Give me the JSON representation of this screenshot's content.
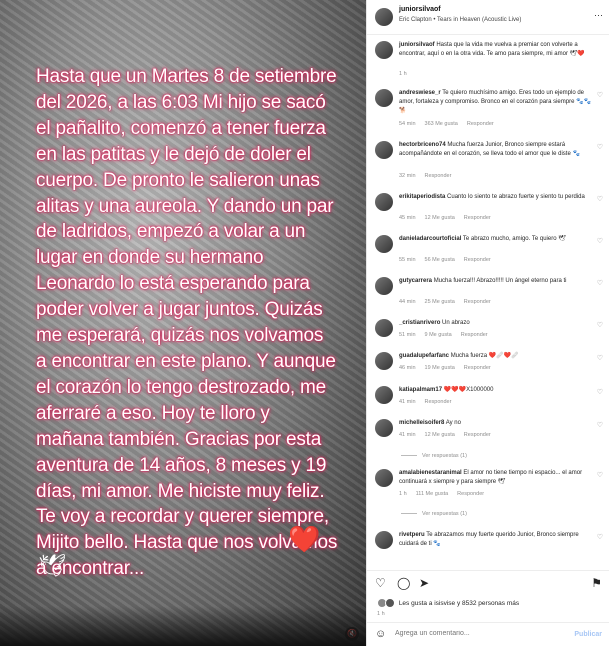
{
  "post": {
    "text": "Hasta que un Martes 8 de setiembre del 2026, a las 6:03 Mi hijo se sacó el pañalito, comenzó a tener fuerza en las patitas y le dejó de doler el cuerpo. De pronto le salieron unas alitas y una aureola. Y dando un par de ladridos, empezó a volar a un lugar en donde su hermano Leonardo lo está esperando para poder volver a jugar juntos. Quizás me esperará, quizás nos volvamos a encontrar en este plano. Y aunque el corazón lo tengo destrozado, me aferraré a eso. Hoy te lloro y mañana también. Gracias por esta aventura de 14 años, 8 meses y 19 días, mi amor. Me hiciste muy feliz. Te voy a recordar y querer siempre, Mijito bello. Hasta que nos volvamos a encontrar...",
    "heart": "❤️",
    "dove": "🕊"
  },
  "header": {
    "username": "juniorsilvaof",
    "song": "Eric Clapton • Tears in Heaven (Acoustic Live)",
    "more": "···"
  },
  "caption": {
    "username": "juniorsilvaof",
    "text": "Hasta que la vida me vuelva a premiar con volverte a encontrar, aquí o en la otra vida. Te amo para siempre, mi amor 🕊❤️",
    "time": "1 h"
  },
  "comments": [
    {
      "user": "andreswiese_r",
      "text": "Te quiero muchísimo amigo. Eres todo un ejemplo de amor, fortaleza y compromiso. Bronco en el corazón para siempre 🐾🐾🐕",
      "time": "54 min",
      "likes": "363 Me gusta",
      "reply": "Responder"
    },
    {
      "user": "hectorbriceno74",
      "text": "Mucha fuerza Junior, Bronco siempre estará acompañándote en el corazón, se lleva todo el amor que le diste 🐾",
      "time": "32 min",
      "likes": "",
      "reply": "Responder"
    },
    {
      "user": "erikitaperiodista",
      "text": "Cuanto lo siento te abrazo fuerte y siento tu perdida",
      "time": "45 min",
      "likes": "12 Me gusta",
      "reply": "Responder"
    },
    {
      "user": "danieladarcourtoficial",
      "text": "Te abrazo mucho, amigo. Te quiero 🕊",
      "time": "55 min",
      "likes": "56 Me gusta",
      "reply": "Responder"
    },
    {
      "user": "gutycarrera",
      "text": "Mucha fuerza!!! Abrazo!!!!! Un ángel eterno para ti",
      "time": "44 min",
      "likes": "25 Me gusta",
      "reply": "Responder"
    },
    {
      "user": "_cristianrivero",
      "text": "Un abrazo",
      "time": "51 min",
      "likes": "9 Me gusta",
      "reply": "Responder"
    },
    {
      "user": "guadalupefarfanc",
      "text": "Mucha fuerza ❤️🩹❤️🩹",
      "time": "46 min",
      "likes": "19 Me gusta",
      "reply": "Responder"
    },
    {
      "user": "katiapalmam17",
      "text": "❤️❤️❤️X1000000",
      "time": "41 min",
      "likes": "",
      "reply": "Responder"
    },
    {
      "user": "michelleisoifer8",
      "text": "Ay no",
      "time": "41 min",
      "likes": "12 Me gusta",
      "reply": "Responder"
    },
    {
      "user": "amalabienestaranimal",
      "text": "El amor no tiene tiempo ni espacio... el amor continuará x siempre y para siempre 🕊",
      "time": "1 h",
      "likes": "111 Me gusta",
      "reply": "Responder"
    },
    {
      "user": "rivetperu",
      "text": "Te abrazamos muy fuerte querido Junior, Bronco siempre cuidará de ti 🐾",
      "time": "",
      "likes": "",
      "reply": ""
    }
  ],
  "view_replies": [
    "Ver respuestas (1)",
    "Ver respuestas (1)"
  ],
  "likes_summary": "Les gusta a isisvise y 8532 personas más",
  "post_time": "1 h",
  "comment_box": {
    "placeholder": "Agrega un comentario...",
    "publish": "Publicar"
  },
  "colors": {
    "text_glow": "#e0205a",
    "link": "#0095f6"
  }
}
